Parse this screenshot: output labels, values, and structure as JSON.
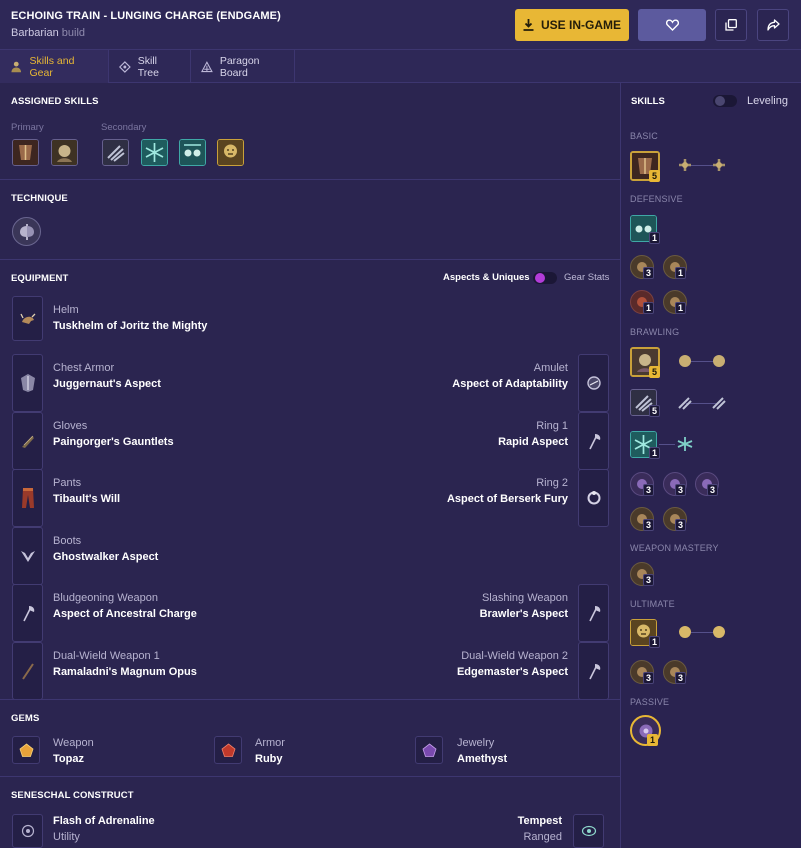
{
  "header": {
    "title": "ECHOING TRAIN - LUNGING CHARGE (ENDGAME)",
    "class_name": "Barbarian",
    "build_word": "build",
    "use_label": "USE IN-GAME"
  },
  "tabs": [
    {
      "label": "Skills and Gear"
    },
    {
      "label": "Skill Tree"
    },
    {
      "label": "Paragon Board"
    }
  ],
  "assigned": {
    "heading": "ASSIGNED SKILLS",
    "primary_label": "Primary",
    "secondary_label": "Secondary"
  },
  "technique": {
    "heading": "TECHNIQUE"
  },
  "equipment": {
    "heading": "EQUIPMENT",
    "toggle_left": "Aspects & Uniques",
    "toggle_right": "Gear Stats",
    "left": [
      {
        "type": "Helm",
        "name": "Tuskhelm of Joritz the Mighty"
      },
      {
        "type": "Chest Armor",
        "name": "Juggernaut's Aspect"
      },
      {
        "type": "Gloves",
        "name": "Paingorger's Gauntlets"
      },
      {
        "type": "Pants",
        "name": "Tibault's Will"
      },
      {
        "type": "Boots",
        "name": "Ghostwalker Aspect"
      },
      {
        "type": "Bludgeoning Weapon",
        "name": "Aspect of Ancestral Charge"
      },
      {
        "type": "Dual-Wield Weapon 1",
        "name": "Ramaladni's Magnum Opus"
      }
    ],
    "right": [
      {
        "type": "Amulet",
        "name": "Aspect of Adaptability"
      },
      {
        "type": "Ring 1",
        "name": "Rapid Aspect"
      },
      {
        "type": "Ring 2",
        "name": "Aspect of Berserk Fury"
      },
      {
        "type": "Slashing Weapon",
        "name": "Brawler's Aspect"
      },
      {
        "type": "Dual-Wield Weapon 2",
        "name": "Edgemaster's Aspect"
      }
    ]
  },
  "gems": {
    "heading": "GEMS",
    "items": [
      {
        "slot": "Weapon",
        "name": "Topaz"
      },
      {
        "slot": "Armor",
        "name": "Ruby"
      },
      {
        "slot": "Jewelry",
        "name": "Amethyst"
      }
    ]
  },
  "seneschal": {
    "heading": "SENESCHAL CONSTRUCT",
    "left_name": "Flash of Adrenaline",
    "left_sub": "Utility",
    "right_name": "Tempest",
    "right_sub": "Ranged"
  },
  "skills_panel": {
    "heading": "SKILLS",
    "toggle_label": "Leveling",
    "sections": {
      "basic": "BASIC",
      "defensive": "DEFENSIVE",
      "brawling": "BRAWLING",
      "weapon_mastery": "WEAPON MASTERY",
      "ultimate": "ULTIMATE",
      "passive": "PASSIVE"
    },
    "counts": {
      "basic": "5",
      "def1": "1",
      "def2": "3",
      "def3": "1",
      "def4": "1",
      "def5": "1",
      "brawl1": "5",
      "brawl2": "5",
      "brawl3": "1",
      "brawl4": "3",
      "brawl5": "3",
      "brawl6": "3",
      "brawl7": "3",
      "brawl8": "3",
      "wm1": "3",
      "ult1": "1",
      "ult2": "3",
      "ult3": "3",
      "pass1": "1"
    }
  },
  "colors": {
    "accent_gold": "#e8b735",
    "background": "#2b2550",
    "toggle_on": "#b23cd8"
  }
}
